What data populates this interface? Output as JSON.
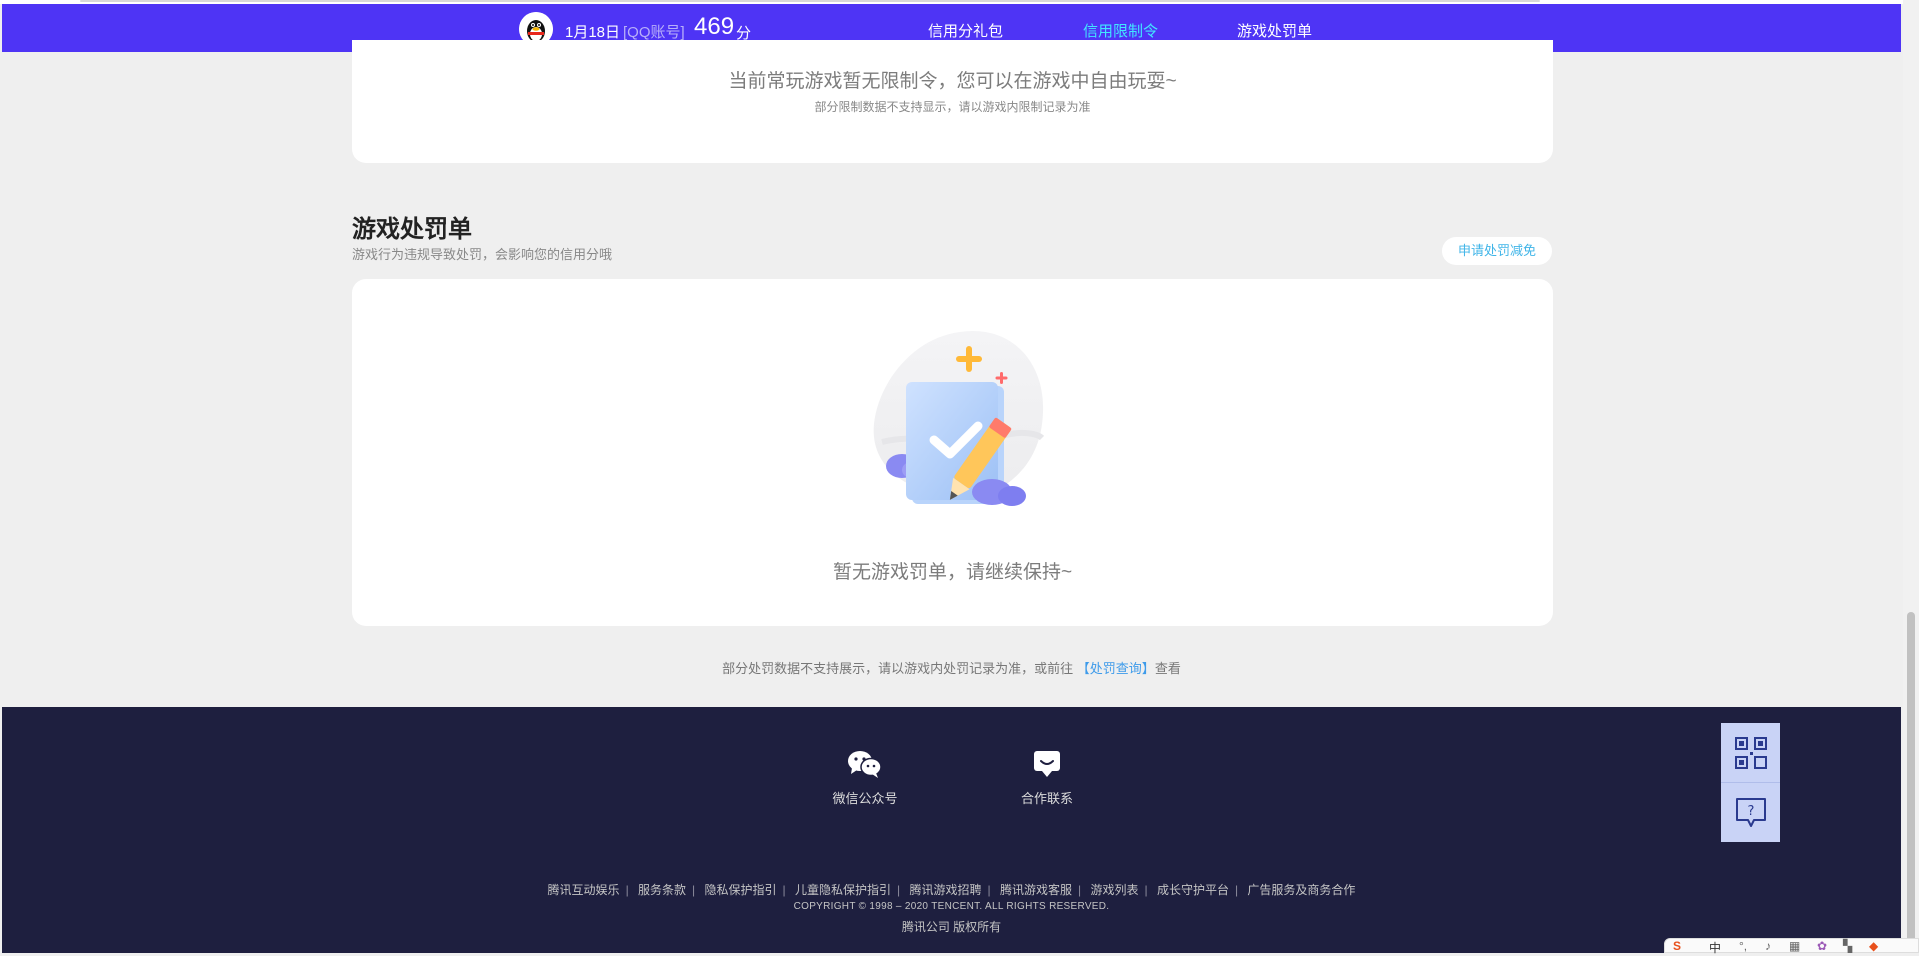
{
  "nav": {
    "date": "1月18日",
    "account_type": "[QQ账号]",
    "score": "469",
    "score_unit": "分",
    "links": [
      "信用分礼包",
      "信用限制令",
      "游戏处罚单"
    ],
    "active_index": 1
  },
  "restriction": {
    "message": "当前常玩游戏暂无限制令，您可以在游戏中自由玩耍~",
    "note": "部分限制数据不支持显示，请以游戏内限制记录为准"
  },
  "penalty": {
    "title": "游戏处罚单",
    "subtitle": "游戏行为违规导致处罚，会影响您的信用分哦",
    "appeal_button": "申请处罚减免",
    "empty_message": "暂无游戏罚单，请继续保持~",
    "bottom_note_prefix": "部分处罚数据不支持展示，请以游戏内处罚记录为准，或前往",
    "bottom_note_link": "【处罚查询】",
    "bottom_note_suffix": "查看"
  },
  "footer": {
    "wechat_label": "微信公众号",
    "cooperation_label": "合作联系",
    "links": [
      "腾讯互动娱乐",
      "服务条款",
      "隐私保护指引",
      "儿童隐私保护指引",
      "腾讯游戏招聘",
      "腾讯游戏客服",
      "游戏列表",
      "成长守护平台",
      "广告服务及商务合作"
    ],
    "copyright": "COPYRIGHT © 1998 – 2020 TENCENT. ALL RIGHTS RESERVED.",
    "company": "腾讯公司 版权所有"
  },
  "side_float": {
    "qr_icon": "qr-code-icon",
    "help_icon": "help-chat-icon"
  },
  "ime": {
    "logo": "S",
    "mode": "中"
  },
  "colors": {
    "nav_bg": "#4e34f5",
    "nav_active": "#42e6ff",
    "page_bg": "#efefef",
    "footer_bg": "#1e1f3f",
    "link_blue": "#3e9bea",
    "appeal_text": "#40b5e8"
  }
}
